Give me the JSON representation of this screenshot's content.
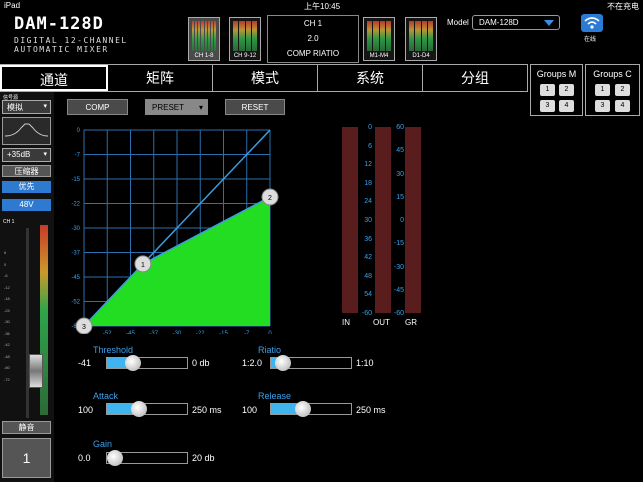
{
  "status": {
    "left": "iPad",
    "time": "上午10:45",
    "right": "不在充电"
  },
  "logo": {
    "title": "DAM-128D",
    "sub1": "DIGITAL 12-CHANNEL",
    "sub2": "AUTOMATIC MIXER"
  },
  "meters": [
    "CH 1-8",
    "CH 9-12",
    "M1-M4",
    "D1-D4"
  ],
  "channel": {
    "name": "CH 1",
    "value": "2.0",
    "param": "COMP RIATIO"
  },
  "model": {
    "label": "Model",
    "value": "DAM-128D"
  },
  "wifi": {
    "label": "在线"
  },
  "tabs": [
    "通道",
    "矩阵",
    "模式",
    "系统",
    "分组"
  ],
  "groupsM": {
    "title": "Groups M",
    "buttons": [
      "1",
      "2",
      "3",
      "4"
    ]
  },
  "groupsC": {
    "title": "Groups C",
    "buttons": [
      "1",
      "2",
      "3",
      "4"
    ]
  },
  "sidebar": {
    "signal_label": "信号源",
    "source": "模拟",
    "gain": "+35dB",
    "comp": "压缩器",
    "priority": "优先",
    "phantom": "48V",
    "ch": "CH 1",
    "mute": "静音",
    "channel_num": "1",
    "scale": [
      "6",
      "0",
      "-6",
      "-12",
      "-18",
      "-24",
      "-30",
      "-36",
      "-42",
      "-48",
      "-60",
      "-72"
    ]
  },
  "toolbar": {
    "comp": "COMP",
    "preset": "PRESET",
    "reset": "RESET"
  },
  "chart_data": {
    "type": "line",
    "x_ticks": [
      "-63",
      "-52",
      "-45",
      "-37",
      "-30",
      "-22",
      "-15",
      "-7",
      "0"
    ],
    "y_ticks": [
      "0",
      "-7",
      "-15",
      "-22",
      "-30",
      "-37",
      "-45",
      "-52",
      "-60"
    ],
    "xlim": [
      -60,
      0
    ],
    "ylim": [
      -60,
      0
    ],
    "points": [
      {
        "label": "3",
        "x": -60,
        "y": -60
      },
      {
        "label": "1",
        "x": -41,
        "y": -41
      },
      {
        "label": "2",
        "x": 0,
        "y": -20.5
      }
    ]
  },
  "meters_right": {
    "scale_in": [
      "0",
      "6",
      "12",
      "18",
      "24",
      "30",
      "36",
      "42",
      "48",
      "54",
      "-60"
    ],
    "scale_gr": [
      "60",
      "45",
      "30",
      "15",
      "0",
      "-15",
      "-30",
      "-45",
      "-60"
    ],
    "labels": [
      "IN",
      "OUT",
      "GR"
    ]
  },
  "params": {
    "threshold": {
      "label": "Threshold",
      "value": "-41",
      "max": "0 db",
      "level": 0.32
    },
    "ratio": {
      "label": "Riatio",
      "value": "1:2.0",
      "max": "1:10",
      "level": 0.15
    },
    "attack": {
      "label": "Attack",
      "value": "100",
      "max": "250 ms",
      "level": 0.4
    },
    "release": {
      "label": "Release",
      "value": "100",
      "max": "250 ms",
      "level": 0.4
    },
    "gain": {
      "label": "Gain",
      "value": "0.0",
      "max": "20 db",
      "level": 0
    }
  }
}
